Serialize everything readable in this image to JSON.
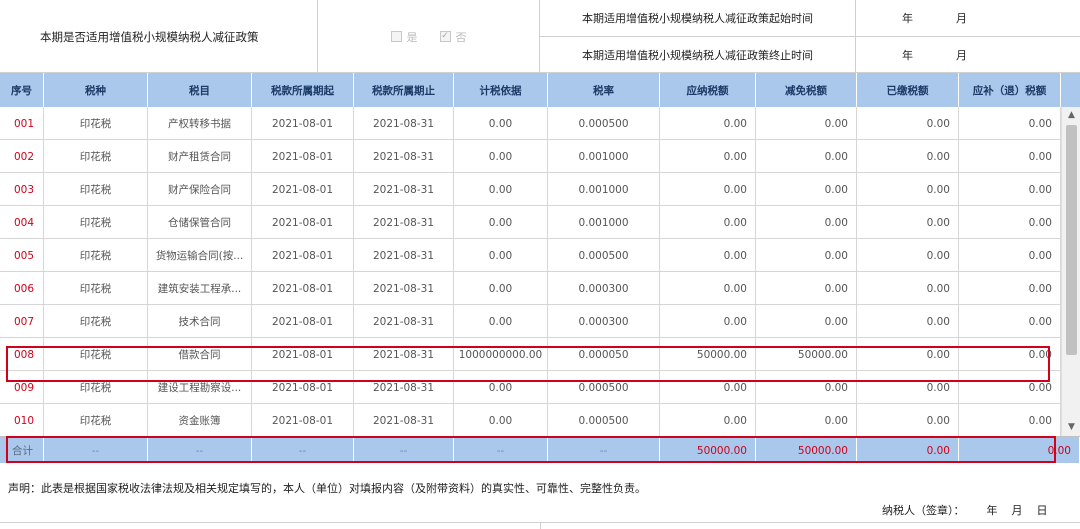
{
  "header": {
    "policy_question": "本期是否适用增值税小规模纳税人减征政策",
    "option_yes": "是",
    "option_no": "否",
    "start_label": "本期适用增值税小规模纳税人减征政策起始时间",
    "end_label": "本期适用增值税小规模纳税人减征政策终止时间",
    "year": "年",
    "month": "月"
  },
  "columns": [
    "序号",
    "税种",
    "税目",
    "税款所属期起",
    "税款所属期止",
    "计税依据",
    "税率",
    "应纳税额",
    "减免税额",
    "已缴税额",
    "应补（退）税额"
  ],
  "rows": [
    {
      "seq": "001",
      "tax": "印花税",
      "item": "产权转移书据",
      "from": "2021-08-01",
      "to": "2021-08-31",
      "base": "0.00",
      "rate": "0.000500",
      "payable": "0.00",
      "relief": "0.00",
      "paid": "0.00",
      "due": "0.00"
    },
    {
      "seq": "002",
      "tax": "印花税",
      "item": "财产租赁合同",
      "from": "2021-08-01",
      "to": "2021-08-31",
      "base": "0.00",
      "rate": "0.001000",
      "payable": "0.00",
      "relief": "0.00",
      "paid": "0.00",
      "due": "0.00"
    },
    {
      "seq": "003",
      "tax": "印花税",
      "item": "财产保险合同",
      "from": "2021-08-01",
      "to": "2021-08-31",
      "base": "0.00",
      "rate": "0.001000",
      "payable": "0.00",
      "relief": "0.00",
      "paid": "0.00",
      "due": "0.00"
    },
    {
      "seq": "004",
      "tax": "印花税",
      "item": "仓储保管合同",
      "from": "2021-08-01",
      "to": "2021-08-31",
      "base": "0.00",
      "rate": "0.001000",
      "payable": "0.00",
      "relief": "0.00",
      "paid": "0.00",
      "due": "0.00"
    },
    {
      "seq": "005",
      "tax": "印花税",
      "item": "货物运输合同(按...",
      "from": "2021-08-01",
      "to": "2021-08-31",
      "base": "0.00",
      "rate": "0.000500",
      "payable": "0.00",
      "relief": "0.00",
      "paid": "0.00",
      "due": "0.00"
    },
    {
      "seq": "006",
      "tax": "印花税",
      "item": "建筑安装工程承...",
      "from": "2021-08-01",
      "to": "2021-08-31",
      "base": "0.00",
      "rate": "0.000300",
      "payable": "0.00",
      "relief": "0.00",
      "paid": "0.00",
      "due": "0.00"
    },
    {
      "seq": "007",
      "tax": "印花税",
      "item": "技术合同",
      "from": "2021-08-01",
      "to": "2021-08-31",
      "base": "0.00",
      "rate": "0.000300",
      "payable": "0.00",
      "relief": "0.00",
      "paid": "0.00",
      "due": "0.00"
    },
    {
      "seq": "008",
      "tax": "印花税",
      "item": "借款合同",
      "from": "2021-08-01",
      "to": "2021-08-31",
      "base": "1000000000.00",
      "rate": "0.000050",
      "payable": "50000.00",
      "relief": "50000.00",
      "paid": "0.00",
      "due": "0.00"
    },
    {
      "seq": "009",
      "tax": "印花税",
      "item": "建设工程勘察设...",
      "from": "2021-08-01",
      "to": "2021-08-31",
      "base": "0.00",
      "rate": "0.000500",
      "payable": "0.00",
      "relief": "0.00",
      "paid": "0.00",
      "due": "0.00"
    },
    {
      "seq": "010",
      "tax": "印花税",
      "item": "资金账簿",
      "from": "2021-08-01",
      "to": "2021-08-31",
      "base": "0.00",
      "rate": "0.000500",
      "payable": "0.00",
      "relief": "0.00",
      "paid": "0.00",
      "due": "0.00"
    }
  ],
  "total": {
    "label": "合计",
    "placeholder": "--",
    "payable": "50000.00",
    "relief": "50000.00",
    "paid": "0.00",
    "due": "0.00"
  },
  "declaration": "声明：此表是根据国家税收法律法规及相关规定填写的，本人（单位）对填报内容（及附带资料）的真实性、可靠性、完整性负责。",
  "signature": {
    "label": "纳税人（签章）：",
    "year": "年",
    "month": "月",
    "day": "日"
  },
  "colors": {
    "header_bg": "#a9c8ec",
    "highlight": "#d0021b"
  }
}
